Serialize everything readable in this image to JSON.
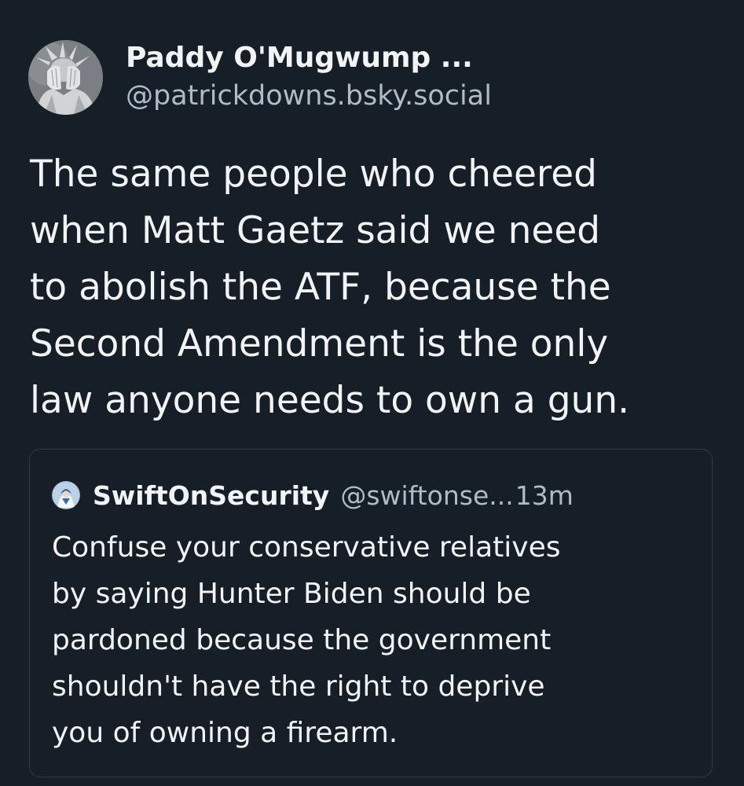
{
  "post": {
    "author": {
      "display_name": "Paddy O'Mugwump ...",
      "handle": "@patrickdowns.bsky.social",
      "avatar_icon": "statue-of-liberty-facepalm-avatar"
    },
    "text": "The same people who cheered\nwhen Matt Gaetz said we need\nto abolish the ATF, because the\nSecond Amendment is the only\nlaw anyone needs to own a gun.",
    "quote": {
      "author": {
        "display_name": "SwiftOnSecurity",
        "handle": "@swiftonse...",
        "avatar_icon": "swiftonsecurity-avatar"
      },
      "time": "13m",
      "text": "Confuse your conservative relatives\nby saying Hunter Biden should be\npardoned because the government\nshouldn't have the right to deprive\nyou of owning a firearm."
    }
  },
  "colors": {
    "background": "#161e27",
    "text_primary": "#f1f3f5",
    "text_secondary": "#aebbc9",
    "card_border": "#2e3a47"
  }
}
